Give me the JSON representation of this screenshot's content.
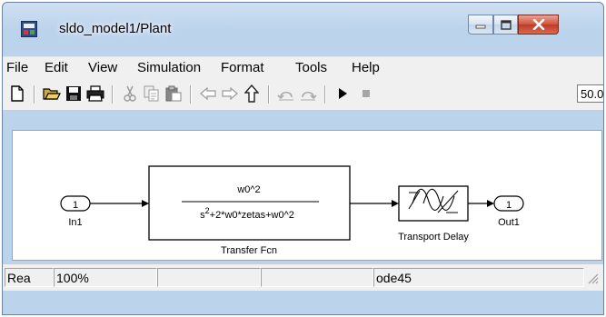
{
  "window": {
    "title": "sldo_model1/Plant",
    "app_icon": "simulink-model-icon",
    "caption_buttons": [
      "minimize-icon",
      "maximize-icon",
      "close-icon"
    ]
  },
  "menu": {
    "items": [
      "File",
      "Edit",
      "View",
      "Simulation",
      "Format",
      "Tools",
      "Help"
    ]
  },
  "toolbar": {
    "buttons": [
      "new-icon",
      "open-icon",
      "save-icon",
      "print-icon",
      "cut-icon",
      "copy-icon",
      "paste-icon",
      "back-icon",
      "forward-icon",
      "up-icon",
      "undo-icon",
      "redo-icon",
      "start-simulation-icon",
      "stop-simulation-icon"
    ],
    "stop_time": "50.0"
  },
  "diagram": {
    "inport": {
      "number": "1",
      "label": "In1"
    },
    "transfer_fcn": {
      "numerator": "w0^2",
      "den_s": "s",
      "den_exp": "2",
      "den_rest": "+2*w0*zetas+w0^2",
      "label": "Transfer Fcn"
    },
    "transport_delay": {
      "label": "Transport Delay"
    },
    "outport": {
      "number": "1",
      "label": "Out1"
    }
  },
  "status": {
    "ready": "Rea",
    "zoom": "100%",
    "field3": "",
    "field4": "",
    "solver": "ode45"
  },
  "colors": {
    "window_frame": "#bcd3ec",
    "close_button": "#c03a22",
    "block_stroke": "#000000",
    "canvas": "#ffffff"
  }
}
